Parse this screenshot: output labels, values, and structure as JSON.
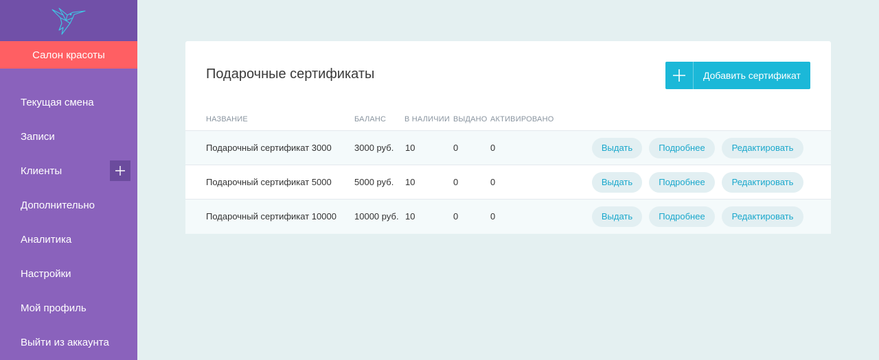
{
  "sidebar": {
    "salon_name": "Салон красоты",
    "items": [
      {
        "label": "Текущая смена"
      },
      {
        "label": "Записи"
      },
      {
        "label": "Клиенты"
      },
      {
        "label": "Дополнительно"
      },
      {
        "label": "Аналитика"
      },
      {
        "label": "Настройки"
      },
      {
        "label": "Мой профиль"
      },
      {
        "label": "Выйти из аккаунта"
      }
    ]
  },
  "page": {
    "title": "Подарочные сертификаты",
    "add_button_label": "Добавить сертификат"
  },
  "table": {
    "headers": {
      "name": "НАЗВАНИЕ",
      "balance": "БАЛАНС",
      "in_stock": "В НАЛИЧИИ",
      "issued": "ВЫДАНО",
      "activated": "АКТИВИРОВАНО"
    },
    "actions": {
      "issue": "Выдать",
      "details": "Подробнее",
      "edit": "Редактировать"
    },
    "rows": [
      {
        "name": "Подарочный сертификат 3000",
        "balance": "3000 руб.",
        "in_stock": "10",
        "issued": "0",
        "activated": "0"
      },
      {
        "name": "Подарочный сертификат 5000",
        "balance": "5000 руб.",
        "in_stock": "10",
        "issued": "0",
        "activated": "0"
      },
      {
        "name": "Подарочный сертификат 10000",
        "balance": "10000 руб.",
        "in_stock": "10",
        "issued": "0",
        "activated": "0"
      }
    ]
  },
  "colors": {
    "sidebar": "#8a62bc",
    "logo_bg": "#7150a8",
    "salon_bar": "#ff5f63",
    "accent": "#1bb8d8"
  },
  "icons": {
    "logo": "hummingbird-icon",
    "add_client": "plus-icon",
    "add_certificate": "plus-icon"
  }
}
